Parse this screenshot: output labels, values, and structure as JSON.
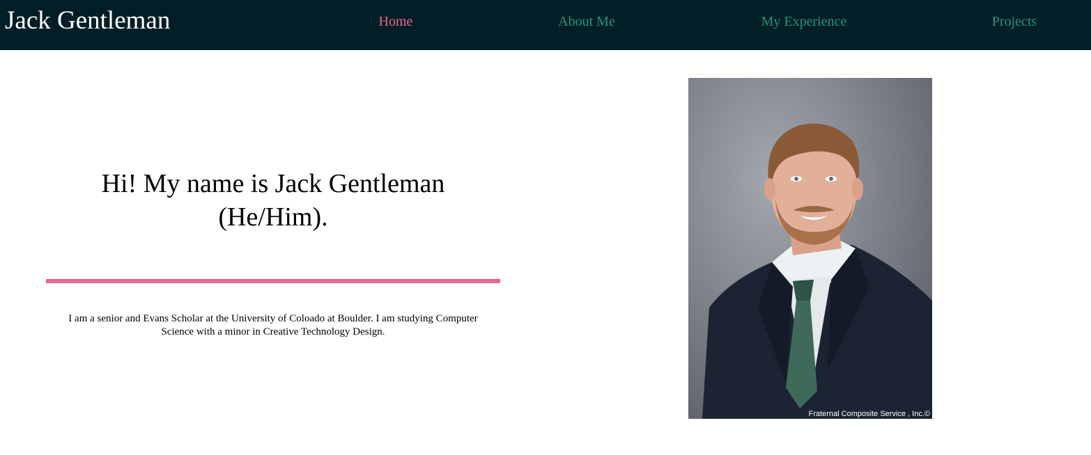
{
  "header": {
    "brand": "Jack Gentleman",
    "nav": [
      {
        "label": "Home",
        "active": true
      },
      {
        "label": "About Me",
        "active": false
      },
      {
        "label": "My Experience",
        "active": false
      },
      {
        "label": "Projects",
        "active": false
      }
    ]
  },
  "hero": {
    "title": "Hi! My name is Jack Gentleman (He/Him).",
    "bio": "I am a senior and Evans Scholar at the University of Coloado at Boulder. I am studying Computer Science with a minor in Creative Technology Design.",
    "photo_credit": "Fraternal Composite Service , Inc.©"
  },
  "colors": {
    "navbar_bg": "#021e26",
    "nav_link": "#1f9a73",
    "nav_active": "#e8688e",
    "divider": "#e8688e"
  }
}
